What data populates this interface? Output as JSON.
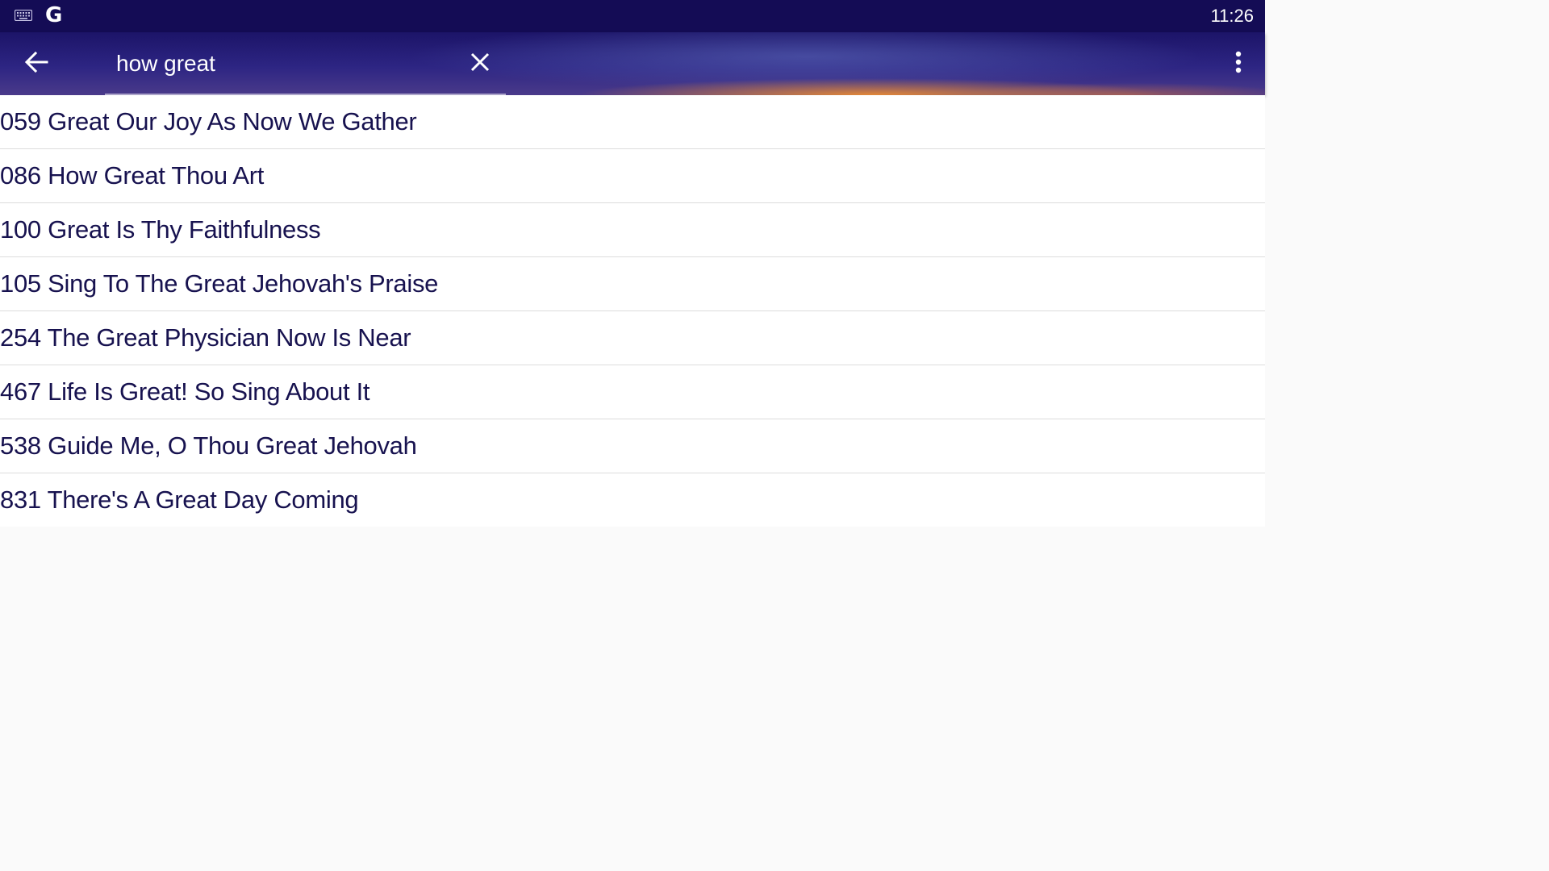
{
  "status_bar": {
    "keyboard_icon": "keyboard-icon",
    "google_icon": "google-g-icon",
    "google_letter": "G",
    "time": "11:26"
  },
  "app_bar": {
    "back_icon": "arrow-back-icon",
    "search": {
      "value": "how great",
      "placeholder": ""
    },
    "clear_icon": "close-icon",
    "more_icon": "more-vert-icon"
  },
  "results": [
    {
      "label": "059 Great Our Joy As Now We Gather"
    },
    {
      "label": "086 How Great Thou Art"
    },
    {
      "label": "100 Great Is Thy Faithfulness"
    },
    {
      "label": "105 Sing To The Great Jehovah's Praise"
    },
    {
      "label": "254 The Great Physician Now Is Near"
    },
    {
      "label": "467 Life Is Great! So Sing About It"
    },
    {
      "label": "538 Guide Me, O Thou Great Jehovah"
    },
    {
      "label": "831 There's A Great Day Coming"
    }
  ],
  "colors": {
    "status_bar_bg": "#140c55",
    "app_bar_bg": "#2d2583",
    "sunset_accent": "#ff9628",
    "result_text": "#17124f",
    "list_bg": "#ffffff",
    "page_bg": "#fafafa"
  }
}
